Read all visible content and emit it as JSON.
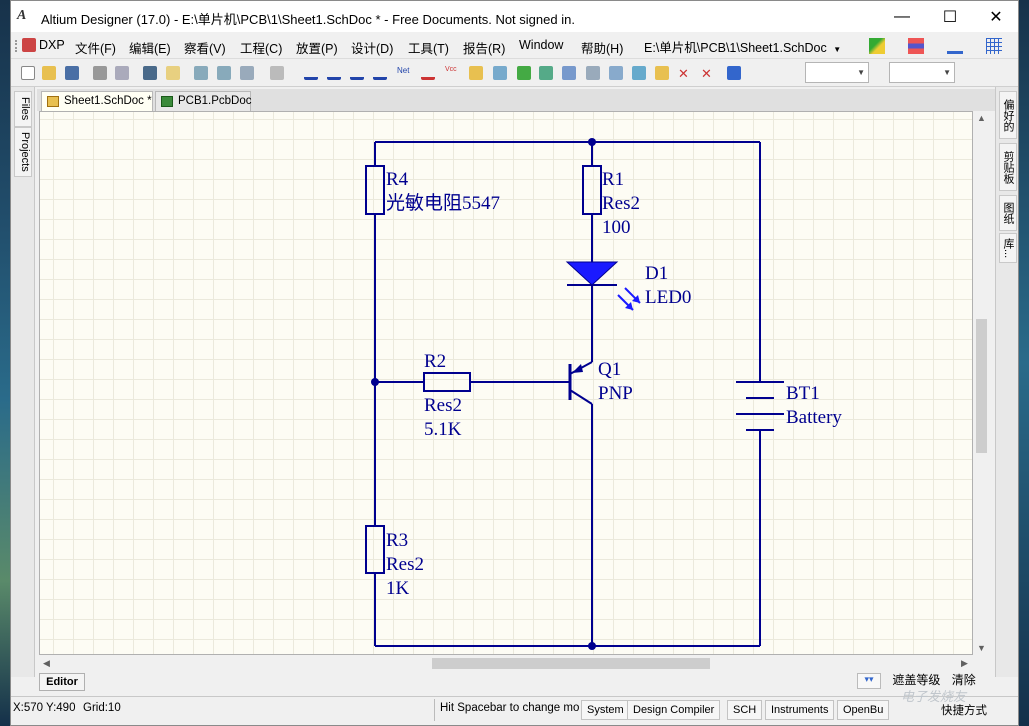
{
  "window": {
    "title": "Altium Designer (17.0) - E:\\单片机\\PCB\\1\\Sheet1.SchDoc * - Free Documents. Not signed in.",
    "minimize": "—",
    "maximize": "☐",
    "close": "✕"
  },
  "menu": {
    "items": [
      "DXP",
      "文件(F)",
      "编辑(E)",
      "察看(V)",
      "工程(C)",
      "放置(P)",
      "设计(D)",
      "工具(T)",
      "报告(R)",
      "Window",
      "帮助(H)"
    ],
    "document_path": "E:\\单片机\\PCB\\1\\Sheet1.SchDoc"
  },
  "left_panel": {
    "tabs": [
      "Files",
      "Projects"
    ]
  },
  "right_panel": {
    "tabs": [
      "偏好的",
      "剪贴板",
      "图纸",
      "库..."
    ]
  },
  "doc_tabs": [
    {
      "label": "Sheet1.SchDoc *",
      "active": true
    },
    {
      "label": "PCB1.PcbDoc",
      "active": false
    }
  ],
  "schematic": {
    "components": {
      "R4": {
        "designator": "R4",
        "comment": "光敏电阻5547"
      },
      "R1": {
        "designator": "R1",
        "comment": "Res2",
        "value": "100"
      },
      "D1": {
        "designator": "D1",
        "comment": "LED0"
      },
      "R2": {
        "designator": "R2",
        "comment": "Res2",
        "value": "5.1K"
      },
      "Q1": {
        "designator": "Q1",
        "comment": "PNP"
      },
      "BT1": {
        "designator": "BT1",
        "comment": "Battery"
      },
      "R3": {
        "designator": "R3",
        "comment": "Res2",
        "value": "1K"
      }
    },
    "wire_color": "#00008f"
  },
  "bottom": {
    "editor_tab": "Editor",
    "mask_level": "遮盖等级",
    "clear": "清除"
  },
  "status": {
    "coords": "X:570 Y:490",
    "grid": "Grid:10",
    "hint": "Hit Spacebar to change mo",
    "panels": [
      "System",
      "Design Compiler",
      "SCH",
      "Instruments",
      "OpenBu"
    ],
    "shortcut": "快捷方式"
  },
  "watermark": "电子发烧友"
}
